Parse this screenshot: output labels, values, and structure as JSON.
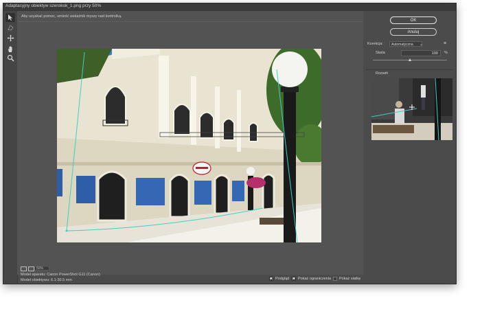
{
  "window": {
    "title": "Adaptacyjny obiektyw szerokok_1.png przy 50%"
  },
  "toolbar": {
    "tools": [
      "constraint-arrow-icon",
      "polygon-constraint-icon",
      "move-icon",
      "hand-icon",
      "zoom-icon"
    ]
  },
  "canvas": {
    "hint": "Aby uzyskać pomoc, umieść wskaźnik myszy nad kontrolką.",
    "zoom": "50%"
  },
  "bottom": {
    "camera_model": "Model aparatu: Canon PowerShot G11 (Canon)",
    "lens_model": "Model obiektywu: 6.1-30.5 mm",
    "checkboxes": [
      {
        "label": "Podgląd",
        "checked": true
      },
      {
        "label": "Pokaż ograniczenia",
        "checked": true
      },
      {
        "label": "Pokaż siatkę",
        "checked": false
      }
    ]
  },
  "panel": {
    "ok_label": "OK",
    "cancel_label": "Anuluj",
    "correction_label": "Korekcja:",
    "correction_value": "Automatyczna",
    "scale_label": "Skala",
    "scale_value": "100",
    "scale_unit": "%",
    "scale_fraction": 0.5,
    "preview_label": "Rozwiń"
  },
  "colors": {
    "window_bg": "#4b4b4b",
    "canvas_bg": "#535353",
    "constraint_line": "#3ecfc2"
  }
}
